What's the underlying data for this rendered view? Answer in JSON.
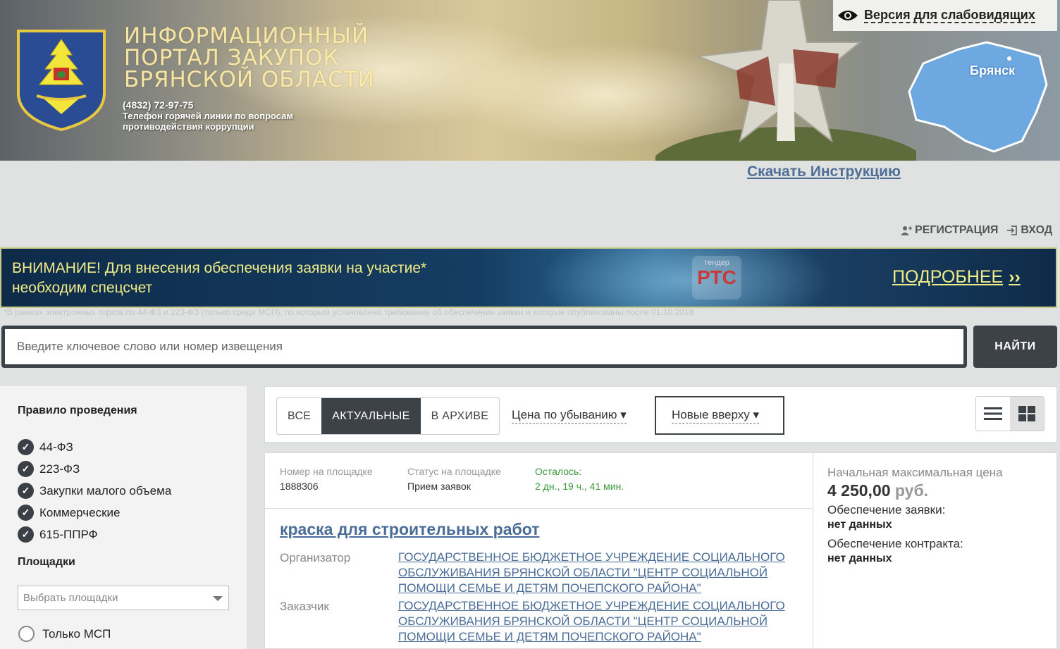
{
  "header": {
    "title_lines": [
      "ИНФОРМАЦИОННЫЙ",
      "ПОРТАЛ ЗАКУПОК",
      "БРЯНСКОЙ ОБЛАСТИ"
    ],
    "phone": "(4832) 72-97-75",
    "hotline_lines": [
      "Телефон горячей линии по вопросам",
      "противодействия коррупции"
    ],
    "region_label": "Брянск",
    "low_vision_label": "Версия для слабовидящих",
    "icons": {
      "low_vision": "eye-icon",
      "coat": "coat-of-arms-icon"
    }
  },
  "top_links": {
    "instruction": "Скачать Инструкцию",
    "register": "РЕГИСТРАЦИЯ",
    "login": "ВХОД"
  },
  "notice": {
    "line1": "ВНИМАНИЕ! Для внесения обеспечения заявки на участие*",
    "line2": "необходим спецсчет",
    "logo_small": "тендер",
    "logo_big": "РТС",
    "more": "ПОДРОБНЕЕ",
    "more_arrows": "››",
    "footnote": "*В рамках электронных торгов по 44-ФЗ и 223-ФЗ (только среди МСП), по которым установлено требование об обеспечении заявки и которые опубликованы после 01.10.2018"
  },
  "search": {
    "placeholder": "Введите ключевое слово или номер извещения",
    "value": "",
    "button": "НАЙТИ"
  },
  "sidebar": {
    "rules_heading": "Правило проведения",
    "rules": [
      {
        "label": "44-ФЗ",
        "checked": true
      },
      {
        "label": "223-ФЗ",
        "checked": true
      },
      {
        "label": "Закупки малого объема",
        "checked": true
      },
      {
        "label": "Коммерческие",
        "checked": true
      },
      {
        "label": "615-ППРФ",
        "checked": true
      }
    ],
    "platforms_heading": "Площадки",
    "platforms_placeholder": "Выбрать площадки",
    "msp_label": "Только МСП"
  },
  "toolbar": {
    "tabs": [
      "ВСЕ",
      "АКТУАЛЬНЫЕ",
      "В АРХИВЕ"
    ],
    "active_tab": "АКТУАЛЬНЫЕ",
    "sort_price": "Цена по убыванию ▾",
    "sort_date": "Новые вверху ▾",
    "view_active": "grid"
  },
  "card": {
    "number_label": "Номер на площадке",
    "number": "1888306",
    "status_label": "Статус на площадке",
    "status": "Прием заявок",
    "remaining_label": "Осталось:",
    "remaining": "2 дн., 19 ч., 41 мин.",
    "title": "краска для строительных работ",
    "organizer_label": "Организатор",
    "organizer": "ГОСУДАРСТВЕННОЕ БЮДЖЕТНОЕ УЧРЕЖДЕНИЕ СОЦИАЛЬНОГО ОБСЛУЖИВАНИЯ БРЯНСКОЙ ОБЛАСТИ \"ЦЕНТР СОЦИАЛЬНОЙ ПОМОЩИ СЕМЬЕ И ДЕТЯМ ПОЧЕПСКОГО РАЙОНА\"",
    "customer_label": "Заказчик",
    "customer": "ГОСУДАРСТВЕННОЕ БЮДЖЕТНОЕ УЧРЕЖДЕНИЕ СОЦИАЛЬНОГО ОБСЛУЖИВАНИЯ БРЯНСКОЙ ОБЛАСТИ \"ЦЕНТР СОЦИАЛЬНОЙ ПОМОЩИ СЕМЬЕ И ДЕТЯМ ПОЧЕПСКОГО РАЙОНА\"",
    "price_label": "Начальная максимальная цена",
    "price": "4 250,00",
    "currency": "руб.",
    "bid_security_label": "Обеспечение заявки:",
    "bid_security": "нет данных",
    "contract_security_label": "Обеспечение контракта:",
    "contract_security": "нет данных"
  },
  "colors": {
    "dark": "#3c4248",
    "link": "#4a6d98",
    "notice_text": "#f1ec86",
    "green": "#3a9a3a"
  }
}
